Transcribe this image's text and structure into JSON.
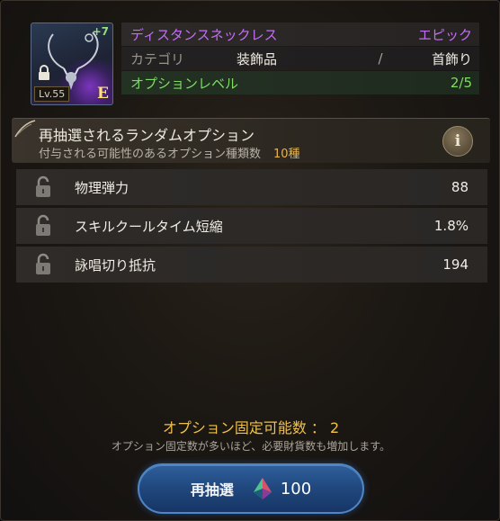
{
  "item": {
    "enhance": "+7",
    "level": "Lv.55",
    "grade_letter": "E",
    "name": "ディスタンスネックレス",
    "grade": "エピック",
    "category_label": "カテゴリ",
    "category_value": "装飾品",
    "category_sep": "/",
    "category_sub": "首飾り",
    "option_level_label": "オプションレベル",
    "option_level_value": "2/5"
  },
  "random_option": {
    "title": "再抽選されるランダムオプション",
    "subtitle": "付与される可能性のあるオプション種類数",
    "count": "10種",
    "info_label": "i"
  },
  "options": [
    {
      "name": "物理弾力",
      "value": "88"
    },
    {
      "name": "スキルクールタイム短縮",
      "value": "1.8%"
    },
    {
      "name": "詠唱切り抵抗",
      "value": "194"
    }
  ],
  "fix": {
    "count_text": "オプション固定可能数 ： 2",
    "note": "オプション固定数が多いほど、必要財貨数も増加します。"
  },
  "reroll": {
    "label": "再抽選",
    "cost": "100",
    "currency_icon": "gem-icon"
  },
  "colors": {
    "epic": "#c26ef4",
    "option_green": "#7fdc62",
    "gold": "#f0c04a",
    "button_blue": "#21497f"
  }
}
